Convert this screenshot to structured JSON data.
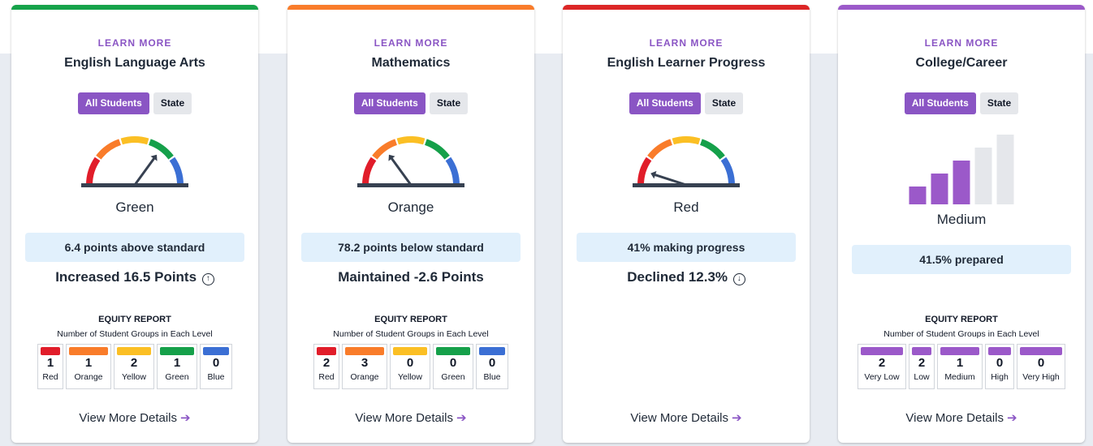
{
  "cards": [
    {
      "accent": "#16a34a",
      "learn_more": "LEARN MORE",
      "title": "English Language Arts",
      "toggle_all": "All Students",
      "toggle_state": "State",
      "level": "Green",
      "status": "6.4 points above standard",
      "change": "Increased 16.5 Points",
      "change_icon": "up-circle-icon",
      "equity_title": "EQUITY REPORT",
      "equity_subtitle": "Number of Student Groups in Each Level",
      "equity": [
        {
          "count": "1",
          "label": "Red",
          "color": "#e11d2a"
        },
        {
          "count": "1",
          "label": "Orange",
          "color": "#f97c2a"
        },
        {
          "count": "2",
          "label": "Yellow",
          "color": "#fbbf24"
        },
        {
          "count": "1",
          "label": "Green",
          "color": "#15a04a"
        },
        {
          "count": "0",
          "label": "Blue",
          "color": "#3b6fd4"
        }
      ],
      "details": "View More Details"
    },
    {
      "accent": "#f97c2a",
      "learn_more": "LEARN MORE",
      "title": "Mathematics",
      "toggle_all": "All Students",
      "toggle_state": "State",
      "level": "Orange",
      "status": "78.2 points below standard",
      "change": "Maintained -2.6 Points",
      "change_icon": "",
      "equity_title": "EQUITY REPORT",
      "equity_subtitle": "Number of Student Groups in Each Level",
      "equity": [
        {
          "count": "2",
          "label": "Red",
          "color": "#e11d2a"
        },
        {
          "count": "3",
          "label": "Orange",
          "color": "#f97c2a"
        },
        {
          "count": "0",
          "label": "Yellow",
          "color": "#fbbf24"
        },
        {
          "count": "0",
          "label": "Green",
          "color": "#15a04a"
        },
        {
          "count": "0",
          "label": "Blue",
          "color": "#3b6fd4"
        }
      ],
      "details": "View More Details"
    },
    {
      "accent": "#dc2626",
      "learn_more": "LEARN MORE",
      "title": "English Learner Progress",
      "toggle_all": "All Students",
      "toggle_state": "State",
      "level": "Red",
      "status": "41% making progress",
      "change": "Declined 12.3%",
      "change_icon": "down-circle-icon",
      "details": "View More Details"
    },
    {
      "accent": "#9b59c9",
      "learn_more": "LEARN MORE",
      "title": "College/Career",
      "toggle_all": "All Students",
      "toggle_state": "State",
      "level": "Medium",
      "level_bars_filled": 3,
      "level_bars_total": 5,
      "status": "41.5% prepared",
      "equity_title": "EQUITY REPORT",
      "equity_subtitle": "Number of Student Groups in Each Level",
      "equity": [
        {
          "count": "2",
          "label": "Very Low",
          "color": "#9b59c9"
        },
        {
          "count": "2",
          "label": "Low",
          "color": "#9b59c9"
        },
        {
          "count": "1",
          "label": "Medium",
          "color": "#9b59c9"
        },
        {
          "count": "0",
          "label": "High",
          "color": "#9b59c9"
        },
        {
          "count": "0",
          "label": "Very High",
          "color": "#9b59c9"
        }
      ],
      "details": "View More Details"
    }
  ],
  "gauge": {
    "segment_colors": [
      "#e11d2a",
      "#f97c2a",
      "#fbbf24",
      "#15a04a",
      "#3b6fd4"
    ],
    "card_needle_level": [
      "Green",
      "Orange",
      "Red"
    ]
  }
}
